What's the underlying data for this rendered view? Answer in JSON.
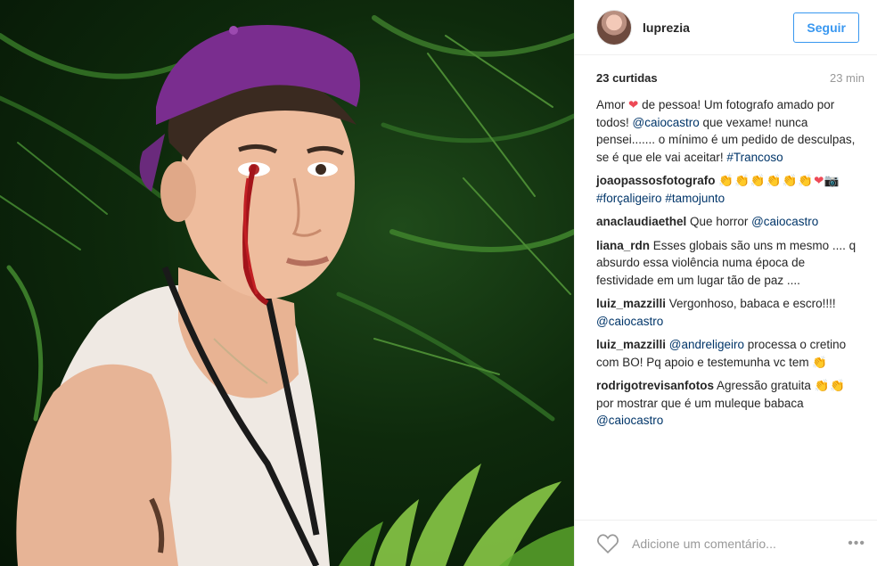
{
  "post": {
    "username": "luprezia",
    "follow_label": "Seguir",
    "likes": "23 curtidas",
    "time": "23 min"
  },
  "caption": {
    "part1": "Amor ",
    "heart": "❤",
    "part2": " de pessoa! Um fotografo amado por todos! ",
    "mention": "@caiocastro",
    "part3": " que vexame! nunca pensei....... o mínimo é um pedido de desculpas, se é que ele vai aceitar! ",
    "hashtag": "#Trancoso"
  },
  "comments": [
    {
      "user": "joaopassosfotografo",
      "text_pre": "",
      "claps": "👏👏👏👏👏👏",
      "heart": "❤",
      "camera": "📷",
      "tag1": "#forçaligeiro",
      "tag2": "#tamojunto"
    },
    {
      "user": "anaclaudiaethel",
      "text": " Que horror ",
      "mention": "@caiocastro"
    },
    {
      "user": "liana_rdn",
      "text": " Esses globais são uns m mesmo .... q absurdo essa violência numa época de festividade em um lugar tão de paz ...."
    },
    {
      "user": "luiz_mazzilli",
      "text": " Vergonhoso, babaca e escro!!!! ",
      "mention": "@caiocastro"
    },
    {
      "user": "luiz_mazzilli",
      "mention_first": " @andreligeiro",
      "text": " processa o cretino com BO! Pq apoio e testemunha vc tem ",
      "claps": "👏"
    },
    {
      "user": "rodrigotrevisanfotos",
      "text": " Agressão gratuita ",
      "claps": "👏👏",
      "text2": " por mostrar que é um muleque babaca ",
      "mention": "@caiocastro"
    }
  ],
  "add_comment": {
    "placeholder": "Adicione um comentário..."
  },
  "icons": {
    "like": "heart-outline-icon",
    "more": "more-options-icon"
  },
  "colors": {
    "link": "#003569",
    "follow": "#3897f0",
    "heart": "#ed4956",
    "cap": "#7a2d8f"
  }
}
